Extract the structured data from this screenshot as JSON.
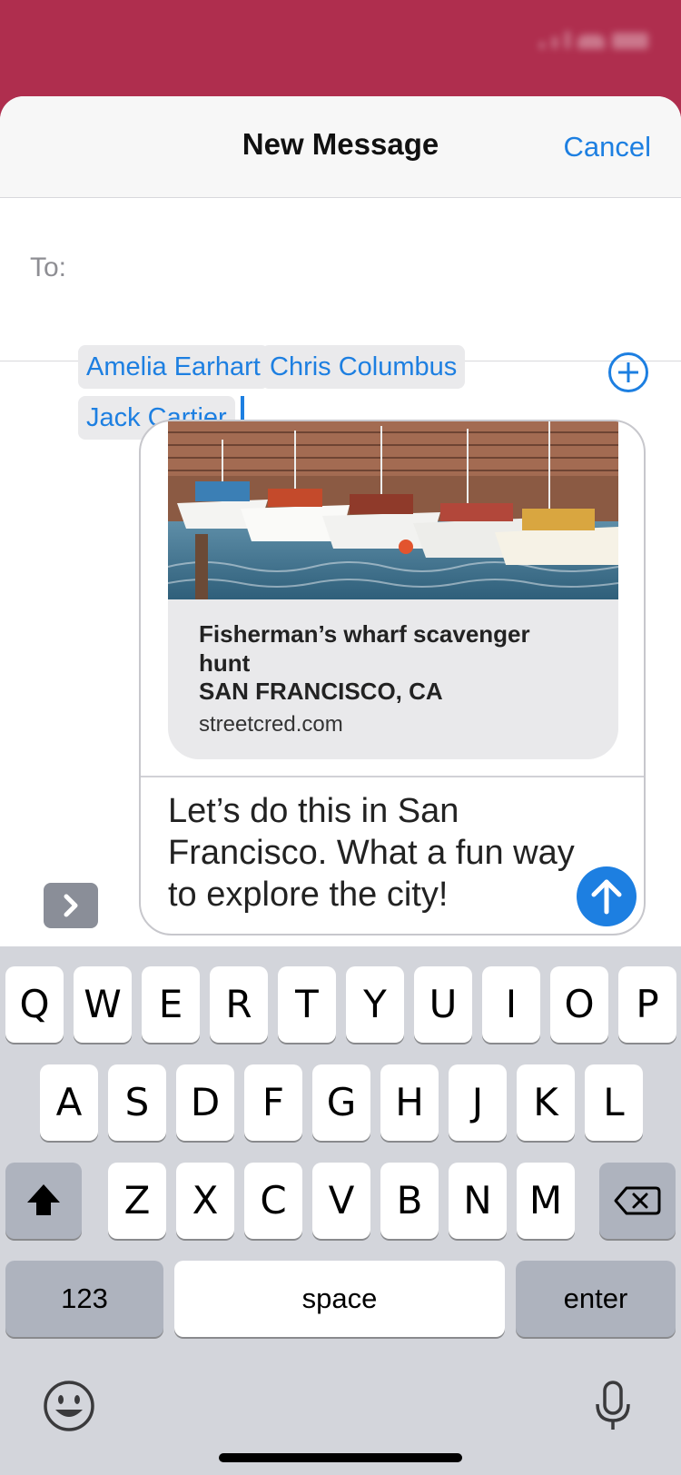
{
  "nav": {
    "title": "New Message",
    "cancel_label": "Cancel"
  },
  "recipients": {
    "label": "To:",
    "chips": [
      "Amelia Earhart",
      "Chris Columbus",
      "Jack Cartier"
    ]
  },
  "link_preview": {
    "title": "Fisherman’s wharf scavenger hunt",
    "location": "SAN FRANCISCO, CA",
    "domain": "streetcred.com"
  },
  "message": {
    "text": "Let’s do this in San Francisco. What a fun way to explore the city!"
  },
  "keyboard": {
    "row1": [
      "Q",
      "W",
      "E",
      "R",
      "T",
      "Y",
      "U",
      "I",
      "O",
      "P"
    ],
    "row2": [
      "A",
      "S",
      "D",
      "F",
      "G",
      "H",
      "J",
      "K",
      "L"
    ],
    "row3": [
      "Z",
      "X",
      "C",
      "V",
      "B",
      "N",
      "M"
    ],
    "numbers_label": "123",
    "space_label": "space",
    "enter_label": "enter"
  },
  "colors": {
    "accent": "#1D7FE1",
    "header": "#AF2E4E",
    "keyboard_bg": "#D3D5DB"
  },
  "icons": {
    "add_contact": "plus-circle-icon",
    "send": "arrow-up-icon",
    "apps": "chevron-right-icon",
    "shift": "shift-arrow-icon",
    "backspace": "delete-icon",
    "emoji": "smiley-icon",
    "dictation": "microphone-icon"
  }
}
